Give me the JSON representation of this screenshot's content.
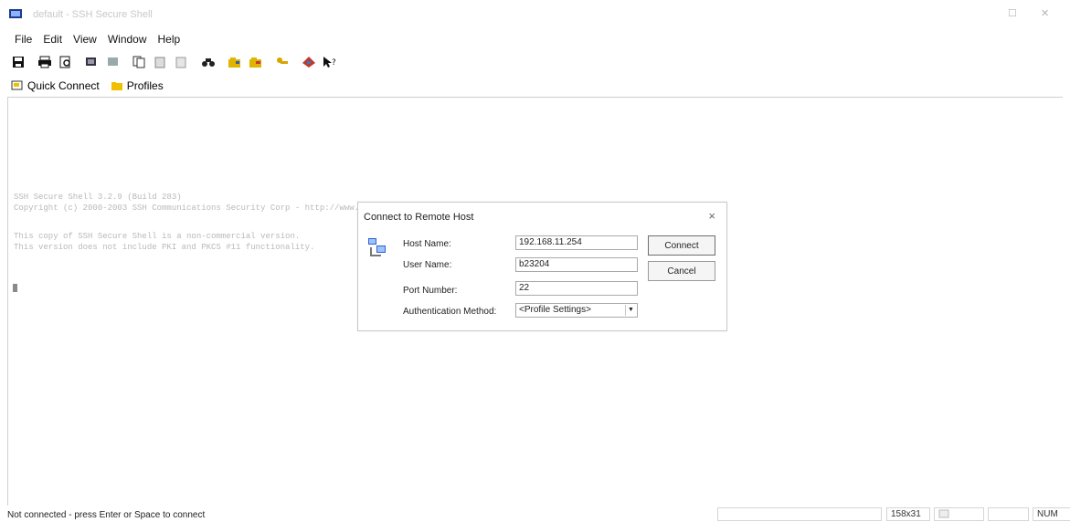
{
  "window": {
    "title": "default - SSH Secure Shell",
    "maximize_glyph": "☐",
    "close_glyph": "✕"
  },
  "menu": [
    {
      "label": "File",
      "key": "F"
    },
    {
      "label": "Edit",
      "key": "E"
    },
    {
      "label": "View",
      "key": "V"
    },
    {
      "label": "Window",
      "key": "W"
    },
    {
      "label": "Help",
      "key": "H"
    }
  ],
  "toolbar": {
    "icons": [
      "save-icon",
      "print-icon",
      "print-preview-icon",
      "terminal-icon",
      "disconnect-icon",
      "copy-icon",
      "paste-icon",
      "paste-special-icon",
      "find-icon",
      "settings-icon",
      "profile-icon",
      "keys-icon",
      "help-icon",
      "context-help-icon"
    ]
  },
  "profilebar": {
    "quick_connect": "Quick Connect",
    "profiles": "Profiles"
  },
  "terminal": {
    "lines": [
      "SSH Secure Shell 3.2.9 (Build 283)",
      "Copyright (c) 2000-2003 SSH Communications Security Corp - http://www.ssh.com/",
      "",
      "This copy of SSH Secure Shell is a non-commercial version.",
      "This version does not include PKI and PKCS #11 functionality."
    ]
  },
  "dialog": {
    "title": "Connect to Remote Host",
    "close": "×",
    "host_name_label": "Host Name:",
    "host_name_value": "192.168.11.254",
    "user_name_label": "User Name:",
    "user_name_value": "b23204",
    "port_label": "Port Number:",
    "port_value": "22",
    "auth_label": "Authentication Method:",
    "auth_value": "<Profile Settings>",
    "connect_button": "Connect",
    "cancel_button": "Cancel"
  },
  "status": {
    "message": "Not connected - press Enter or Space to connect",
    "size": "158x31",
    "num": "NUM"
  }
}
